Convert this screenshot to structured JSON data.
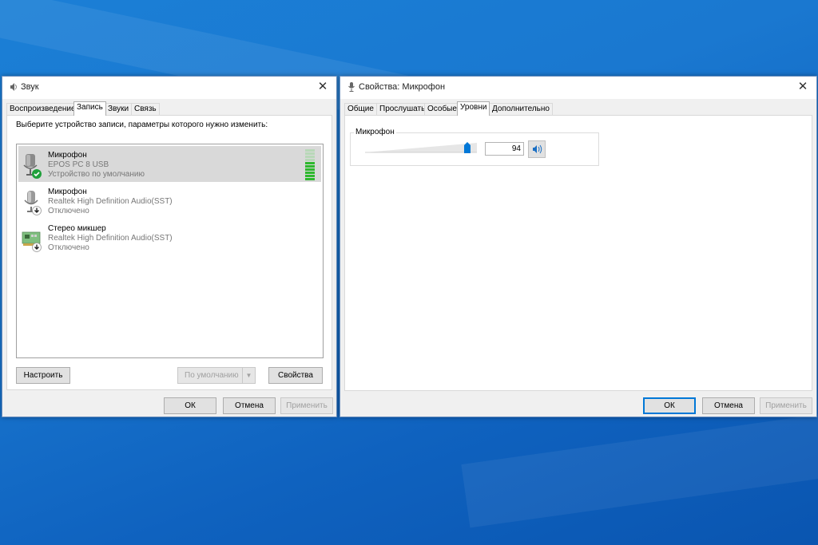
{
  "sound_dialog": {
    "title": "Звук",
    "tabs": [
      "Воспроизведение",
      "Запись",
      "Звуки",
      "Связь"
    ],
    "active_tab": "Запись",
    "instruction": "Выберите устройство записи, параметры которого нужно изменить:",
    "devices": [
      {
        "name": "Микрофон",
        "model": "EPOS PC 8 USB",
        "status": "Устройство по умолчанию",
        "selected": true,
        "badge": "check-icon"
      },
      {
        "name": "Микрофон",
        "model": "Realtek High Definition Audio(SST)",
        "status": "Отключено",
        "selected": false,
        "badge": "arrow-down-icon"
      },
      {
        "name": "Стерео микшер",
        "model": "Realtek High Definition Audio(SST)",
        "status": "Отключено",
        "selected": false,
        "badge": "arrow-down-icon"
      }
    ],
    "level_meter": {
      "active_fraction": 0.55
    },
    "buttons": {
      "configure": "Настроить",
      "set_default": "По умолчанию",
      "properties": "Свойства",
      "ok": "ОК",
      "cancel": "Отмена",
      "apply": "Применить"
    }
  },
  "mic_properties": {
    "title": "Свойства: Микрофон",
    "tabs": [
      "Общие",
      "Прослушать",
      "Особые",
      "Уровни",
      "Дополнительно"
    ],
    "active_tab": "Уровни",
    "level_group_label": "Микрофон",
    "level_value": "94",
    "slider_value": 94,
    "buttons": {
      "ok": "ОК",
      "cancel": "Отмена",
      "apply": "Применить"
    }
  },
  "colors": {
    "accent": "#0078d7",
    "meter_green": "#2eb82e",
    "badge_green": "#1fa03a"
  }
}
